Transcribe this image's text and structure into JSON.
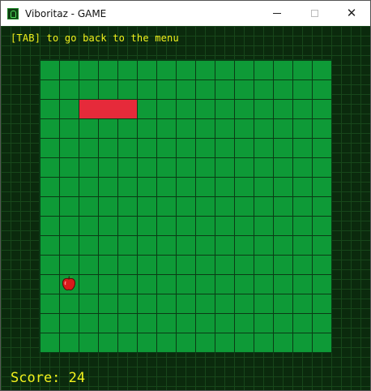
{
  "window": {
    "title": "Viboritaz - GAME",
    "icon": "snake-app-icon",
    "controls": [
      "minimize",
      "maximize",
      "close"
    ]
  },
  "game": {
    "hint": "[TAB] to go back to the menu",
    "score_text": "Score: 24",
    "colors": {
      "background": "#0b2a0d",
      "board": "#0e9a37",
      "grid_lines": "#0a3b15",
      "snake": "#e62a3a",
      "text": "#f2f21c"
    },
    "board": {
      "columns": 15,
      "rows": 15,
      "snake_cells": [
        [
          2,
          2
        ],
        [
          3,
          2
        ],
        [
          4,
          2
        ]
      ],
      "apple_cell": [
        1,
        11
      ]
    }
  }
}
